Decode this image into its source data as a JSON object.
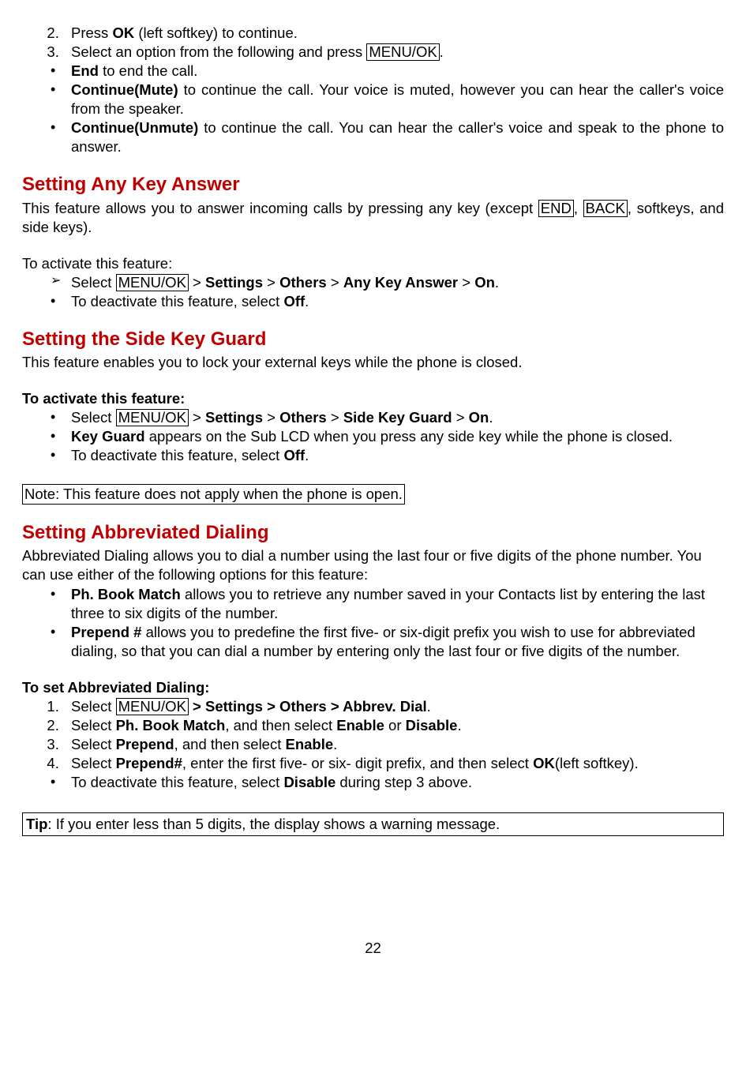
{
  "ord": {
    "i2_a": "Press ",
    "i2_ok": "OK",
    "i2_b": " (left softkey) to continue.",
    "i3_a": "Select an option from the following and press ",
    "i3_menuok": "MENU/OK",
    "i3_b": "."
  },
  "top_bullets": {
    "b1_bold": "End",
    "b1_rest": " to end the call.",
    "b2_bold": "Continue(Mute)",
    "b2_rest": " to continue the call. Your voice is muted, however you can hear the caller's voice from the speaker.",
    "b3_bold": "Continue(Unmute)",
    "b3_rest": " to continue the call. You can hear the caller's voice and speak to the phone to answer."
  },
  "aka": {
    "heading": "Setting Any Key Answer",
    "intro_a": "This feature allows you to answer incoming calls by pressing any key (except ",
    "end_key": "END",
    "comma": ",  ",
    "back_key": "BACK",
    "intro_b": ", softkeys, and side keys).",
    "toactivate": "To activate this feature:",
    "arrow_a": "Select ",
    "arrow_menuok": "MENU/OK",
    "arrow_b": " > ",
    "settings": "Settings",
    "others": "Others",
    "anykey": "Any Key Answer",
    "on": "On",
    "arrow_end": ".",
    "bullet_off_a": "To deactivate this feature, select ",
    "bullet_off_bold": "Off",
    "bullet_off_b": "."
  },
  "skg": {
    "heading": "Setting the Side Key Guard",
    "intro": "This feature enables you to lock your external keys while the phone is closed.",
    "toactivate": "To activate this feature:",
    "b1_a": "Select ",
    "b1_menuok": "MENU/OK",
    "gt": " > ",
    "settings": "Settings",
    "others": "Others",
    "sidekeyguard": "Side Key Guard",
    "on": "On",
    "b1_end": ".",
    "b2_bold": "Key Guard",
    "b2_rest": " appears on the Sub LCD when you press any side key while the phone is closed.",
    "b3_a": "To deactivate this feature, select ",
    "b3_bold": "Off",
    "b3_b": ".",
    "note": "Note: This feature does not apply when the phone is open."
  },
  "abd": {
    "heading": "Setting Abbreviated Dialing",
    "intro": "Abbreviated Dialing allows you to dial a number using the last four or five digits of the phone number. You can use either of the following options for this feature:",
    "b1_bold": "Ph. Book Match",
    "b1_rest": " allows you to retrieve any number saved in your Contacts list by entering the last three to six digits of the number.",
    "b2_bold": "Prepend #",
    "b2_rest": " allows you to predefine the first five- or six-digit prefix you wish to use for abbreviated dialing, so that you can dial a number by entering only the last four or five digits of the number.",
    "toset": "To set Abbreviated Dialing:",
    "s1_a": "Select ",
    "s1_menuok": "MENU/OK",
    "s1_b": " > Settings > Others > Abbrev. Dial",
    "s1_end": ".",
    "s2_a": "Select ",
    "s2_ph": "Ph. Book Match",
    "s2_b": ", and then select ",
    "s2_en": "Enable",
    "s2_or": " or ",
    "s2_dis": "Disable",
    "s2_end": ".",
    "s3_a": "Select ",
    "s3_prepend": "Prepend",
    "s3_b": ", and then select ",
    "s3_en": "Enable",
    "s3_end": ".",
    "s4_a": "Select ",
    "s4_prepend": "Prepend#",
    "s4_b": ", enter the first five- or six- digit prefix, and then select ",
    "s4_ok": "OK",
    "s4_c": "(left softkey).",
    "b_last_a": "To deactivate this feature, select ",
    "b_last_bold": "Disable",
    "b_last_b": " during step 3 above.",
    "tip_bold": "Tip",
    "tip_rest": ": If you enter less than 5 digits, the display shows a warning message."
  },
  "page": "22"
}
